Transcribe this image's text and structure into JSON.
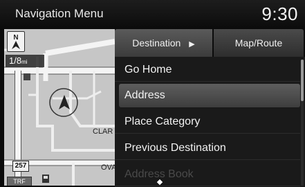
{
  "header": {
    "title": "Navigation Menu",
    "time": "9:30"
  },
  "map": {
    "scale_value": "1/8",
    "scale_unit": "mi",
    "street_label_1": "CLAR",
    "street_label_2": "OVA",
    "route_shield": "257",
    "badge_label": "TRF"
  },
  "tabs": {
    "destination_label": "Destination",
    "destination_arrow": "▶",
    "map_route_label": "Map/Route"
  },
  "menu": {
    "items": [
      {
        "label": "Go Home"
      },
      {
        "label": "Address"
      },
      {
        "label": "Place Category"
      },
      {
        "label": "Previous Destination"
      },
      {
        "label": "Address Book"
      }
    ]
  }
}
